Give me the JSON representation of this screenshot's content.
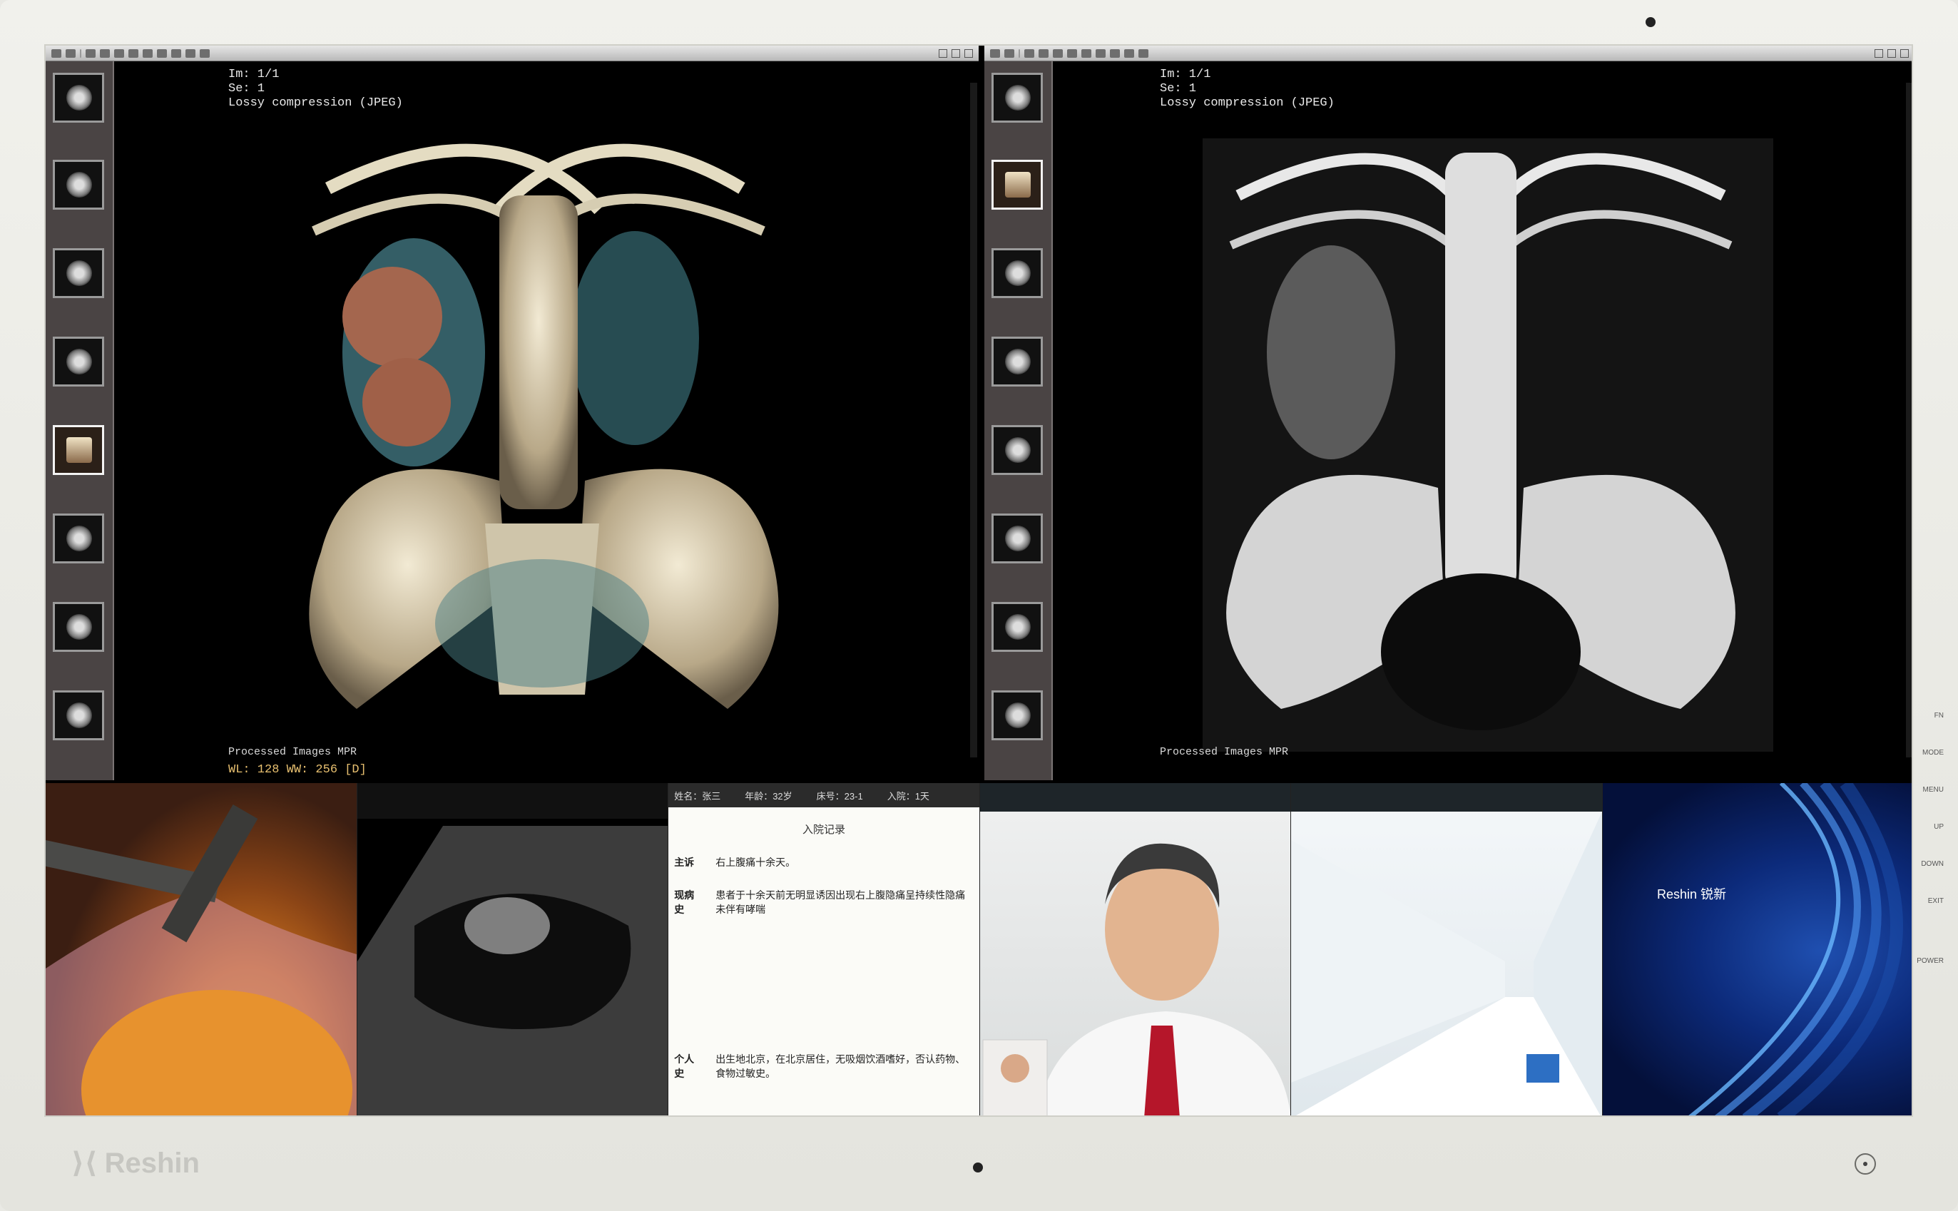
{
  "viewer_left": {
    "overlay_top": [
      "Im: 1/1",
      "Se: 1",
      "Lossy compression (JPEG)"
    ],
    "footer_label": "Processed Images MPR",
    "wl_ww": "WL: 128 WW: 256 [D]"
  },
  "viewer_right": {
    "overlay_top": [
      "Im: 1/1",
      "Se: 1",
      "Lossy compression (JPEG)"
    ],
    "footer_label": "Processed Images MPR"
  },
  "doc": {
    "title": "入院记录",
    "header": [
      "姓名：张三",
      "年龄：32岁",
      "床号：23-1",
      "入院：1天"
    ],
    "rows": [
      {
        "label": "主诉",
        "text": "右上腹痛十余天。"
      },
      {
        "label": "现病史",
        "text": "患者于十余天前无明显诱因出现右上腹隐痛呈持续性隐痛未伴有哮喘"
      },
      {
        "label": "个人史",
        "text": "出生地北京，在北京居住，无吸烟饮酒嗜好，否认药物、食物过敏史。"
      }
    ]
  },
  "osd_buttons": [
    "FN",
    "MODE",
    "MENU",
    "UP",
    "DOWN",
    "EXIT",
    "POWER"
  ],
  "brand": {
    "logo_text": "Reshin",
    "splash_text": "Reshin 锐新"
  },
  "colors": {
    "bezel": "#e9e9e4",
    "screen": "#000000",
    "toolbar": "#c8c8c8",
    "thumbstrip": "#4a4444"
  }
}
